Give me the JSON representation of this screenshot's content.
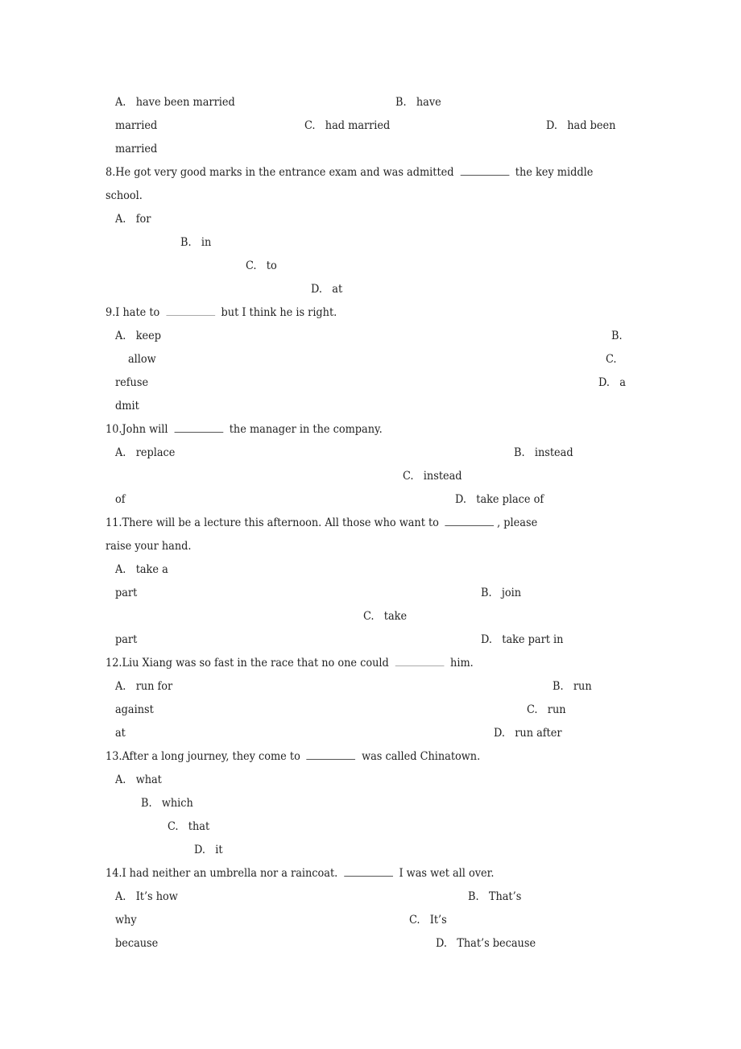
{
  "q7": {
    "options": {
      "a_label": "A.",
      "a_text": "have been married",
      "b_label": "B.",
      "b_text_1": "have",
      "b_text_2": "married",
      "c_label": "C.",
      "c_text": "had married",
      "d_label": "D.",
      "d_text_1": "had been",
      "d_text_2": "married"
    }
  },
  "q8": {
    "number": "8.",
    "stem_before": "He got very good marks in the entrance exam and was admitted",
    "stem_after": "the key middle",
    "stem_cont": "school.",
    "options": {
      "a_label": "A.",
      "a_text": "for",
      "b_label": "B.",
      "b_text": "in",
      "c_label": "C.",
      "c_text": "to",
      "d_label": "D.",
      "d_text": "at"
    }
  },
  "q9": {
    "number": "9.",
    "stem_before": "I hate to",
    "stem_after": "but I think he is right.",
    "options": {
      "a_label": "A.",
      "a_text": "keep",
      "b_label": "B.",
      "b_text": "allow",
      "c_label": "C.",
      "c_text": "refuse",
      "d_label": "D.",
      "d_text_1": "a",
      "d_text_2": "dmit"
    }
  },
  "q10": {
    "number": "10.",
    "stem_before": "John will",
    "stem_after": "the manager in the company.",
    "options": {
      "a_label": "A.",
      "a_text": "replace",
      "b_label": "B.",
      "b_text": "instead",
      "c_label": "C.",
      "c_text_1": "instead",
      "c_text_2": "of",
      "d_label": "D.",
      "d_text": "take place of"
    }
  },
  "q11": {
    "number": "11.",
    "stem_before": "There will be a lecture this afternoon. All those who want to",
    "stem_after": ", please",
    "stem_cont": "raise your hand.",
    "options": {
      "a_label": "A.",
      "a_text_1": "take a",
      "a_text_2": "part",
      "b_label": "B.",
      "b_text": "join",
      "c_label": "C.",
      "c_text_1": "take",
      "c_text_2": "part",
      "d_label": "D.",
      "d_text": "take part in"
    }
  },
  "q12": {
    "number": "12.",
    "stem_before": "Liu Xiang was so fast in the race that no one could",
    "stem_after": "him.",
    "options": {
      "a_label": "A.",
      "a_text": "run for",
      "b_label": "B.",
      "b_text_1": "run",
      "b_text_2": "against",
      "c_label": "C.",
      "c_text_1": "run",
      "c_text_2": "at",
      "d_label": "D.",
      "d_text": "run after"
    }
  },
  "q13": {
    "number": "13.",
    "stem_before": "After a long journey, they come to",
    "stem_after": "was called Chinatown.",
    "options": {
      "a_label": "A.",
      "a_text": "what",
      "b_label": "B.",
      "b_text": "which",
      "c_label": "C.",
      "c_text": "that",
      "d_label": "D.",
      "d_text": "it"
    }
  },
  "q14": {
    "number": "14.",
    "stem_before": "I had neither an umbrella nor a raincoat.",
    "stem_after": "I was wet all over.",
    "options": {
      "a_label": "A.",
      "a_text_1": "It’s how",
      "a_text_2": "why",
      "b_label": "B.",
      "b_text": "That’s",
      "c_label": "C.",
      "c_text_1": "It’s",
      "c_text_2": "because",
      "d_label": "D.",
      "d_text": "That’s because"
    }
  }
}
